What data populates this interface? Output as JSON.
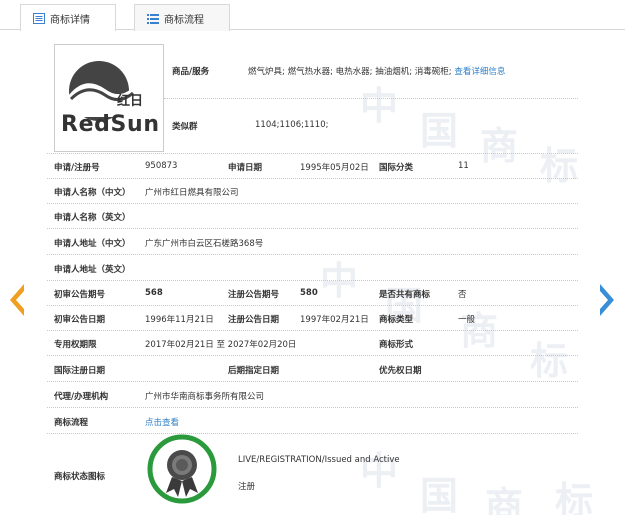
{
  "tabs": [
    {
      "label": "商标详情",
      "active": true,
      "icon": "document-icon"
    },
    {
      "label": "商标流程",
      "active": false,
      "icon": "list-icon"
    }
  ],
  "logo": {
    "text": "RedSun",
    "cn": "红日"
  },
  "goods": {
    "label": "商品/服务",
    "value": "燃气炉具; 燃气热水器; 电热水器; 抽油烟机; 消毒碗柜;",
    "link": "查看详细信息"
  },
  "similar_group": {
    "label": "类似群",
    "value": "1104;1106;1110;"
  },
  "fields": {
    "reg_no": {
      "label": "申请/注册号",
      "value": "950873"
    },
    "app_date": {
      "label": "申请日期",
      "value": "1995年05月02日"
    },
    "intl_class": {
      "label": "国际分类",
      "value": "11"
    },
    "applicant_cn": {
      "label": "申请人名称（中文）",
      "value": "广州市红日燃具有限公司"
    },
    "applicant_en": {
      "label": "申请人名称（英文）",
      "value": ""
    },
    "address_cn": {
      "label": "申请人地址（中文）",
      "value": "广东广州市白云区石槎路368号"
    },
    "address_en": {
      "label": "申请人地址（英文）",
      "value": ""
    },
    "prelim_no": {
      "label": "初审公告期号",
      "value": "568"
    },
    "reg_pub_no": {
      "label": "注册公告期号",
      "value": "580"
    },
    "shared": {
      "label": "是否共有商标",
      "value": "否"
    },
    "prelim_date": {
      "label": "初审公告日期",
      "value": "1996年11月21日"
    },
    "reg_pub_date": {
      "label": "注册公告日期",
      "value": "1997年02月21日"
    },
    "mark_type": {
      "label": "商标类型",
      "value": "一般"
    },
    "exclusive_period": {
      "label": "专用权期限",
      "value": "2017年02月21日 至 2027年02月20日"
    },
    "mark_form": {
      "label": "商标形式",
      "value": ""
    },
    "intl_reg_date": {
      "label": "国际注册日期",
      "value": ""
    },
    "later_date": {
      "label": "后期指定日期",
      "value": ""
    },
    "priority_date": {
      "label": "优先权日期",
      "value": ""
    },
    "agent": {
      "label": "代理/办理机构",
      "value": "广州市华南商标事务所有限公司"
    },
    "process": {
      "label": "商标流程",
      "value": "点击查看"
    },
    "status_icon": {
      "label": "商标状态图标",
      "status_en": "LIVE/REGISTRATION/Issued and Active",
      "status_cn": "注册"
    }
  },
  "colors": {
    "link": "#2e7fc7",
    "left_arrow": "#f0a020",
    "right_arrow": "#3a8ed6",
    "badge_ring": "#2a9a3c"
  },
  "watermark": [
    "中",
    "国",
    "商",
    "标"
  ]
}
